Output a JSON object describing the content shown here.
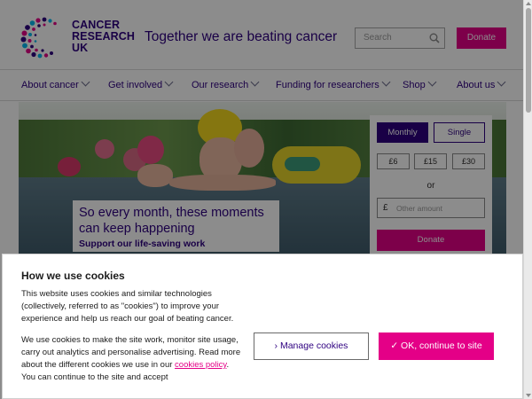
{
  "header": {
    "logo_text_line1": "CANCER",
    "logo_text_line2": "RESEARCH",
    "logo_text_line3": "UK",
    "tagline": "Together we are beating cancer",
    "search_placeholder": "Search",
    "donate_label": "Donate"
  },
  "nav": {
    "items": [
      {
        "label": "About cancer"
      },
      {
        "label": "Get involved"
      },
      {
        "label": "Our research"
      },
      {
        "label": "Funding for researchers"
      },
      {
        "label": "Shop"
      },
      {
        "label": "About us"
      }
    ]
  },
  "hero": {
    "caption_title": "So every month, these moments can keep happening",
    "caption_subtitle": "Support our life-saving work"
  },
  "donate_panel": {
    "monthly_label": "Monthly",
    "single_label": "Single",
    "amounts": [
      "£6",
      "£15",
      "£30"
    ],
    "or_label": "or",
    "currency_symbol": "£",
    "other_amount_placeholder": "Other amount",
    "donate_label": "Donate"
  },
  "cookie_banner": {
    "title": "How we use cookies",
    "paragraph1": "This website uses cookies and similar technologies (collectively, referred to as \"cookies\") to improve your experience and help us reach our goal of beating cancer.",
    "paragraph2_before_link": "We use cookies to make the site work, monitor site usage, carry out analytics and personalise advertising. Read more about the different cookies we use in our ",
    "policy_link": "cookies policy",
    "paragraph2_after_link": ". You can continue to the site and accept",
    "manage_label": "› Manage cookies",
    "ok_label": "✓ OK, continue to site"
  },
  "colors": {
    "brand_navy": "#2e0080",
    "brand_pink": "#e40087"
  }
}
